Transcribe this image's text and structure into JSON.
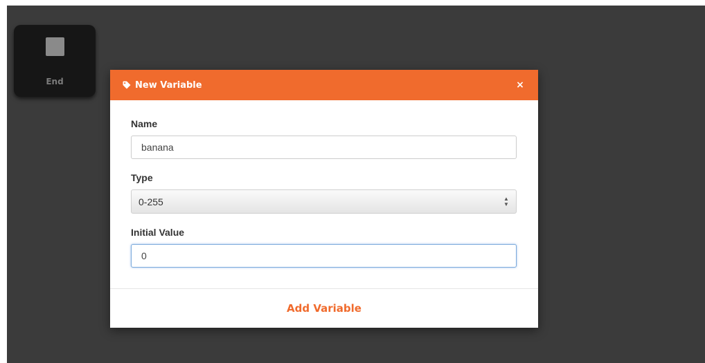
{
  "colors": {
    "accent": "#f06b2d",
    "canvas_background": "#3b3b3b",
    "block_background": "#161616"
  },
  "canvas_block": {
    "label": "End",
    "icon": "stop-icon"
  },
  "dialog": {
    "title": "New Variable",
    "title_icon": "tag-icon",
    "close_label": "×",
    "fields": {
      "name": {
        "label": "Name",
        "value": "banana"
      },
      "type": {
        "label": "Type",
        "value": "0-255"
      },
      "initial_value": {
        "label": "Initial Value",
        "value": "0"
      }
    },
    "submit_label": "Add Variable"
  }
}
